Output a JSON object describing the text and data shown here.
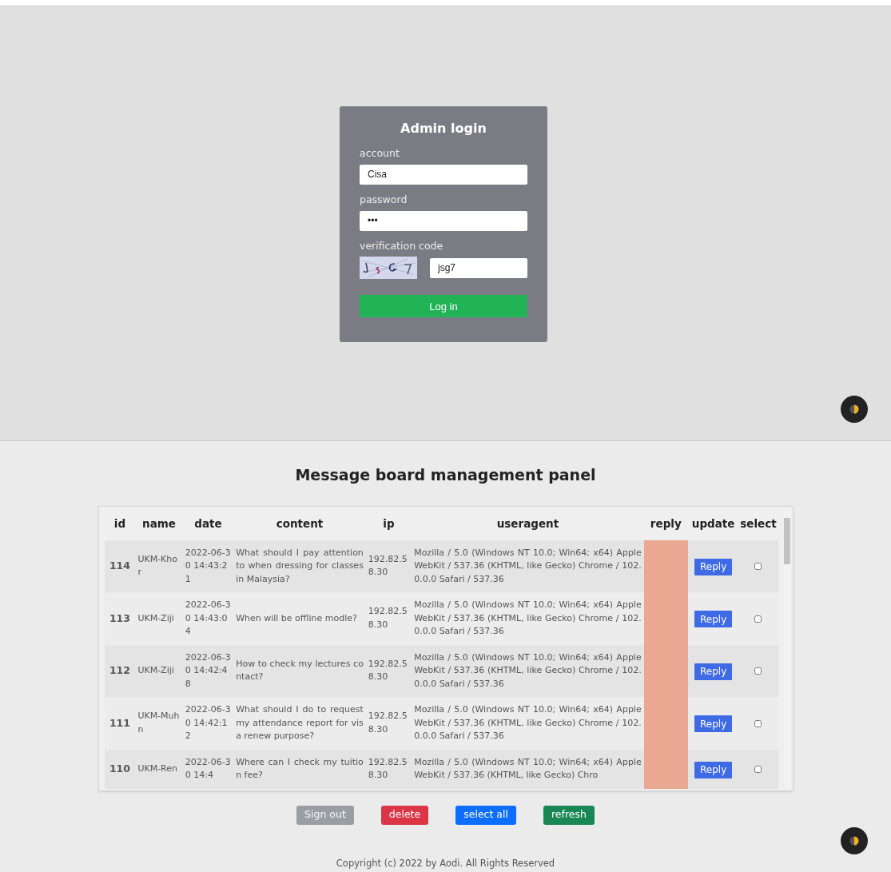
{
  "login": {
    "title": "Admin login",
    "account": {
      "label": "account",
      "value": "Cisa"
    },
    "password": {
      "label": "password",
      "value": "•••"
    },
    "verification": {
      "label": "verification code",
      "value": "jsg7"
    },
    "submit": "Log in"
  },
  "panel": {
    "title": "Message board management panel",
    "table": {
      "columns": [
        "id",
        "name",
        "date",
        "content",
        "ip",
        "useragent",
        "reply",
        "update",
        "select"
      ],
      "rows": [
        {
          "id": "114",
          "name": "UKM-Khor",
          "date": "2022-06-30 14:43:21",
          "content": "What should I pay attention to when dressing for classes in Malaysia?",
          "ip": "192.82.58.30",
          "useragent": "Mozilla / 5.0 (Windows NT 10.0; Win64; x64) AppleWebKit / 537.36 (KHTML, like Gecko) Chrome / 102.0.0.0 Safari / 537.36",
          "update": "Reply",
          "selected": false
        },
        {
          "id": "113",
          "name": "UKM-Ziji",
          "date": "2022-06-30 14:43:04",
          "content": "When will be offline modle?",
          "ip": "192.82.58.30",
          "useragent": "Mozilla / 5.0 (Windows NT 10.0; Win64; x64) AppleWebKit / 537.36 (KHTML, like Gecko) Chrome / 102.0.0.0 Safari / 537.36",
          "update": "Reply",
          "selected": false
        },
        {
          "id": "112",
          "name": "UKM-Ziji",
          "date": "2022-06-30 14:42:48",
          "content": "How to check my lectures contact?",
          "ip": "192.82.58.30",
          "useragent": "Mozilla / 5.0 (Windows NT 10.0; Win64; x64) AppleWebKit / 537.36 (KHTML, like Gecko) Chrome / 102.0.0.0 Safari / 537.36",
          "update": "Reply",
          "selected": false
        },
        {
          "id": "111",
          "name": "UKM-Muhn",
          "date": "2022-06-30 14:42:12",
          "content": "What should I do to request my attendance report for visa renew purpose?",
          "ip": "192.82.58.30",
          "useragent": "Mozilla / 5.0 (Windows NT 10.0; Win64; x64) AppleWebKit / 537.36 (KHTML, like Gecko) Chrome / 102.0.0.0 Safari / 537.36",
          "update": "Reply",
          "selected": false
        },
        {
          "id": "110",
          "name": "UKM-Ren",
          "date": "2022-06-30 14:4",
          "content": "Where can I check my tuition fee?",
          "ip": "192.82.58.30",
          "useragent": "Mozilla / 5.0 (Windows NT 10.0; Win64; x64) AppleWebKit / 537.36 (KHTML, like Gecko) Chro",
          "update": "Reply",
          "selected": false
        }
      ]
    },
    "buttons": [
      {
        "label": "Sign out",
        "kind": "secondary",
        "disabled": true
      },
      {
        "label": "delete",
        "kind": "danger",
        "disabled": false
      },
      {
        "label": "select all",
        "kind": "primary",
        "disabled": false
      },
      {
        "label": "refresh",
        "kind": "success",
        "disabled": false
      }
    ],
    "footer": "Copyright (c) 2022 by Aodi. All Rights Reserved"
  }
}
